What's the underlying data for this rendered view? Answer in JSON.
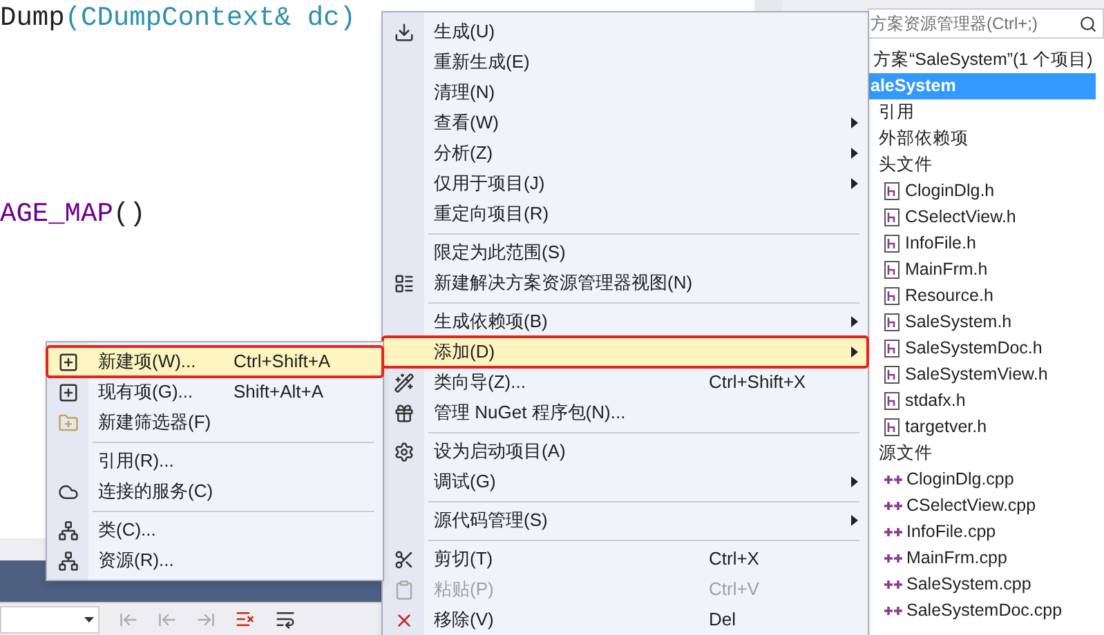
{
  "editor": {
    "lines": [
      {
        "kind": "call",
        "text": "Dump",
        "args": "(CDumpContext& dc)"
      },
      {
        "kind": "macro",
        "text": "AGE_MAP",
        "args": "()"
      }
    ]
  },
  "solution_explorer": {
    "search": {
      "placeholder": "方案资源管理器(Ctrl+;)"
    },
    "tree": [
      {
        "label": "方案“SaleSystem”(1 个项目)",
        "selected": false,
        "children": [
          {
            "label": "aleSystem",
            "selected": true,
            "children": [
              {
                "label": "引用",
                "selected": false
              },
              {
                "label": "外部依赖项",
                "selected": false
              },
              {
                "label": "头文件",
                "selected": false,
                "children": [
                  {
                    "label": "CloginDlg.h",
                    "kind": "header",
                    "selected": false
                  },
                  {
                    "label": "CSelectView.h",
                    "kind": "header",
                    "selected": false
                  },
                  {
                    "label": "InfoFile.h",
                    "kind": "header",
                    "selected": false
                  },
                  {
                    "label": "MainFrm.h",
                    "kind": "header",
                    "selected": false
                  },
                  {
                    "label": "Resource.h",
                    "kind": "header",
                    "selected": false
                  },
                  {
                    "label": "SaleSystem.h",
                    "kind": "header",
                    "selected": false
                  },
                  {
                    "label": "SaleSystemDoc.h",
                    "kind": "header",
                    "selected": false
                  },
                  {
                    "label": "SaleSystemView.h",
                    "kind": "header",
                    "selected": false
                  },
                  {
                    "label": "stdafx.h",
                    "kind": "header",
                    "selected": false
                  },
                  {
                    "label": "targetver.h",
                    "kind": "header",
                    "selected": false
                  }
                ]
              },
              {
                "label": "源文件",
                "selected": false,
                "children": [
                  {
                    "label": "CloginDlg.cpp",
                    "kind": "source",
                    "selected": false
                  },
                  {
                    "label": "CSelectView.cpp",
                    "kind": "source",
                    "selected": false
                  },
                  {
                    "label": "InfoFile.cpp",
                    "kind": "source",
                    "selected": false
                  },
                  {
                    "label": "MainFrm.cpp",
                    "kind": "source",
                    "selected": false
                  },
                  {
                    "label": "SaleSystem.cpp",
                    "kind": "source",
                    "selected": false
                  },
                  {
                    "label": "SaleSystemDoc.cpp",
                    "kind": "source",
                    "selected": false
                  }
                ]
              }
            ]
          }
        ]
      }
    ]
  },
  "context_menu": {
    "items": [
      {
        "kind": "item",
        "label": "生成(U)",
        "submenu": false,
        "disabled": false,
        "selected": false
      },
      {
        "kind": "item",
        "label": "重新生成(E)",
        "submenu": false,
        "disabled": false,
        "selected": false
      },
      {
        "kind": "item",
        "label": "清理(N)",
        "submenu": false,
        "disabled": false,
        "selected": false
      },
      {
        "kind": "item",
        "label": "查看(W)",
        "submenu": true,
        "disabled": false,
        "selected": false
      },
      {
        "kind": "item",
        "label": "分析(Z)",
        "submenu": true,
        "disabled": false,
        "selected": false
      },
      {
        "kind": "item",
        "label": "仅用于项目(J)",
        "submenu": true,
        "disabled": false,
        "selected": false
      },
      {
        "kind": "item",
        "label": "重定向项目(R)",
        "submenu": false,
        "disabled": false,
        "selected": false
      },
      {
        "kind": "separator"
      },
      {
        "kind": "item",
        "label": "限定为此范围(S)",
        "submenu": false,
        "disabled": false,
        "selected": false
      },
      {
        "kind": "item",
        "label": "新建解决方案资源管理器视图(N)",
        "submenu": false,
        "disabled": false,
        "selected": false
      },
      {
        "kind": "separator"
      },
      {
        "kind": "item",
        "label": "生成依赖项(B)",
        "submenu": true,
        "disabled": false,
        "selected": false
      },
      {
        "kind": "item",
        "label": "添加(D)",
        "submenu": true,
        "disabled": false,
        "selected": true
      },
      {
        "kind": "item",
        "label": "类向导(Z)...",
        "shortcut": "Ctrl+Shift+X",
        "submenu": false,
        "disabled": false,
        "selected": false
      },
      {
        "kind": "item",
        "label": "管理 NuGet 程序包(N)...",
        "submenu": false,
        "disabled": false,
        "selected": false
      },
      {
        "kind": "separator"
      },
      {
        "kind": "item",
        "label": "设为启动项目(A)",
        "submenu": false,
        "disabled": false,
        "selected": false
      },
      {
        "kind": "item",
        "label": "调试(G)",
        "submenu": true,
        "disabled": false,
        "selected": false
      },
      {
        "kind": "separator"
      },
      {
        "kind": "item",
        "label": "源代码管理(S)",
        "submenu": true,
        "disabled": false,
        "selected": false
      },
      {
        "kind": "separator"
      },
      {
        "kind": "item",
        "label": "剪切(T)",
        "shortcut": "Ctrl+X",
        "submenu": false,
        "disabled": false,
        "selected": false
      },
      {
        "kind": "item",
        "label": "粘贴(P)",
        "shortcut": "Ctrl+V",
        "submenu": false,
        "disabled": true,
        "selected": false
      },
      {
        "kind": "item",
        "label": "移除(V)",
        "shortcut": "Del",
        "submenu": false,
        "disabled": false,
        "selected": false
      }
    ]
  },
  "add_submenu": {
    "items": [
      {
        "kind": "item",
        "label": "新建项(W)...",
        "shortcut": "Ctrl+Shift+A",
        "selected": true
      },
      {
        "kind": "item",
        "label": "现有项(G)...",
        "shortcut": "Shift+Alt+A",
        "selected": false
      },
      {
        "kind": "item",
        "label": "新建筛选器(F)",
        "selected": false
      },
      {
        "kind": "separator"
      },
      {
        "kind": "item",
        "label": "引用(R)...",
        "selected": false
      },
      {
        "kind": "item",
        "label": "连接的服务(C)",
        "selected": false
      },
      {
        "kind": "separator"
      },
      {
        "kind": "item",
        "label": "类(C)...",
        "selected": false
      },
      {
        "kind": "item",
        "label": "资源(R)...",
        "selected": false
      }
    ]
  }
}
